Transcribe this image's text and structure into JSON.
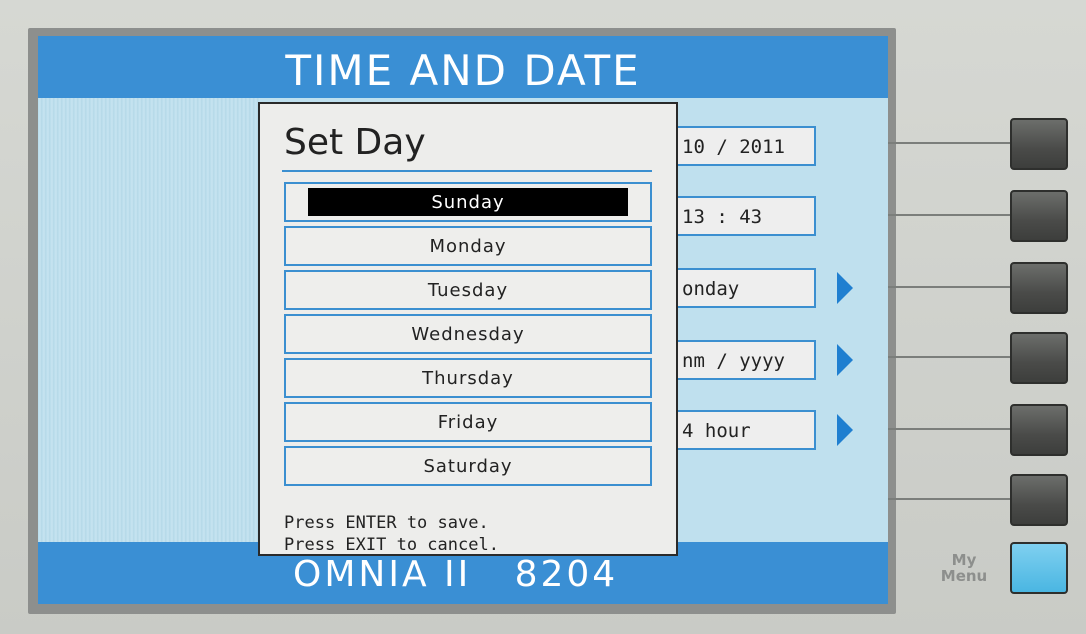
{
  "screen": {
    "title": "TIME AND DATE",
    "footer": "OMNIA II   8204",
    "fields": [
      "10 / 2011",
      "13 : 43",
      "onday",
      "nm / yyyy",
      "4 hour"
    ],
    "arrow_fields": [
      false,
      false,
      true,
      true,
      true
    ]
  },
  "dialog": {
    "title": "Set Day",
    "selected": "Sunday",
    "days": [
      "Sunday",
      "Monday",
      "Tuesday",
      "Wednesday",
      "Thursday",
      "Friday",
      "Saturday"
    ],
    "footer_line1": "Press ENTER to save.",
    "footer_line2": "Press EXIT to cancel."
  },
  "softkeys": {
    "count": 6,
    "my_menu_label": "My\nMenu"
  },
  "colors": {
    "screen_blue": "#3a8fd4",
    "body_light_blue": "#bfe0ee",
    "arrow_blue": "#1f7fd0",
    "my_menu_button": "#4ab6e2"
  }
}
